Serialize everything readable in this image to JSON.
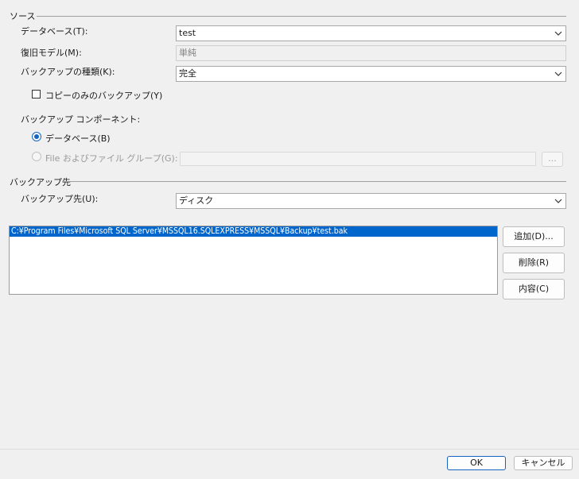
{
  "source": {
    "title": "ソース",
    "database_label": "データベース(T):",
    "database_value": "test",
    "recovery_model_label": "復旧モデル(M):",
    "recovery_model_value": "単純",
    "backup_type_label": "バックアップの種類(K):",
    "backup_type_value": "完全",
    "copy_only_label": "コピーのみのバックアップ(Y)",
    "copy_only_checked": false,
    "component_label": "バックアップ コンポーネント:",
    "component_database_label": "データベース(B)",
    "component_files_label": "File およびファイル グループ(G):",
    "files_browse_label": "..."
  },
  "destination": {
    "title": "バックアップ先",
    "backup_to_label": "バックアップ先(U):",
    "backup_to_value": "ディスク",
    "paths": [
      "C:¥Program Files¥Microsoft SQL Server¥MSSQL16.SQLEXPRESS¥MSSQL¥Backup¥test.bak"
    ],
    "add_label": "追加(D)...",
    "remove_label": "削除(R)",
    "contents_label": "内容(C)"
  },
  "footer": {
    "ok_label": "OK",
    "cancel_label": "キャンセル"
  },
  "colors": {
    "accent": "#1664c0",
    "selection": "#0066cc"
  }
}
